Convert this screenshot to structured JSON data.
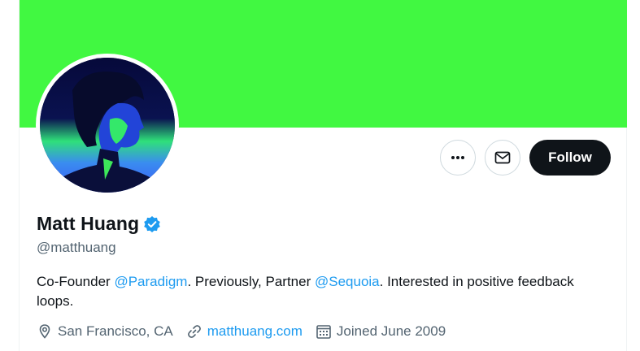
{
  "profile": {
    "display_name": "Matt Huang",
    "handle": "@matthuang",
    "bio": {
      "part1": "Co-Founder ",
      "mention1": "@Paradigm",
      "part2": ". Previously, Partner ",
      "mention2": "@Sequoia",
      "part3": ". Interested in positive feedback loops."
    },
    "location": "San Francisco, CA",
    "website": "matthuang.com",
    "joined": "Joined June 2009"
  },
  "actions": {
    "follow_label": "Follow"
  },
  "colors": {
    "banner": "#41f841",
    "accent": "#1d9bf0",
    "follow_bg": "#0f1419",
    "muted_text": "#536471"
  },
  "icons": {
    "more": "more-horizontal-icon",
    "message": "envelope-icon",
    "verified": "verified-badge-icon",
    "location": "location-pin-icon",
    "link": "link-icon",
    "calendar": "calendar-icon"
  }
}
